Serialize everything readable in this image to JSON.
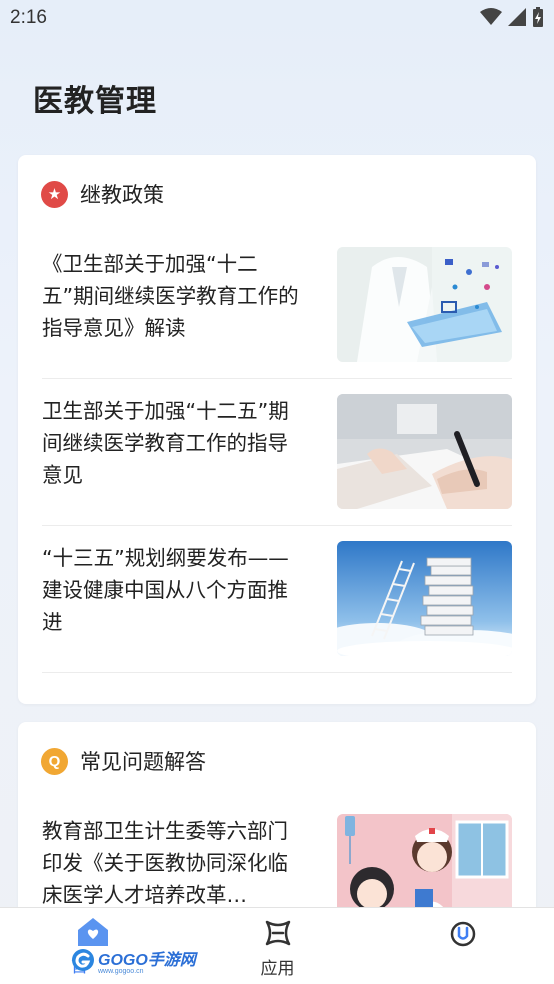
{
  "status_bar": {
    "time": "2:16"
  },
  "page_title": "医教管理",
  "section_policy": {
    "title": "继教政策",
    "articles": [
      {
        "title": "《卫生部关于加强“十二五”期间继续医学教育工作的指导意见》解读"
      },
      {
        "title": "卫生部关于加强“十二五”期间继续医学教育工作的指导意见"
      },
      {
        "title": "“十三五”规划纲要发布——建设健康中国从八个方面推进"
      }
    ]
  },
  "section_faq": {
    "title": "常见问题解答",
    "articles": [
      {
        "title": "教育部卫生计生委等六部门印发《关于医教协同深化临床医学人才培养改革…"
      }
    ]
  },
  "bottom_nav": {
    "home_label": "首",
    "apps_label": "应用",
    "me_label": ""
  },
  "watermark": {
    "text": "GOGO手游网",
    "subtext": "www.gogoo.cn"
  },
  "colors": {
    "accent": "#3f7ef3",
    "policy_icon": "#e04a47",
    "faq_icon": "#f1a733"
  }
}
